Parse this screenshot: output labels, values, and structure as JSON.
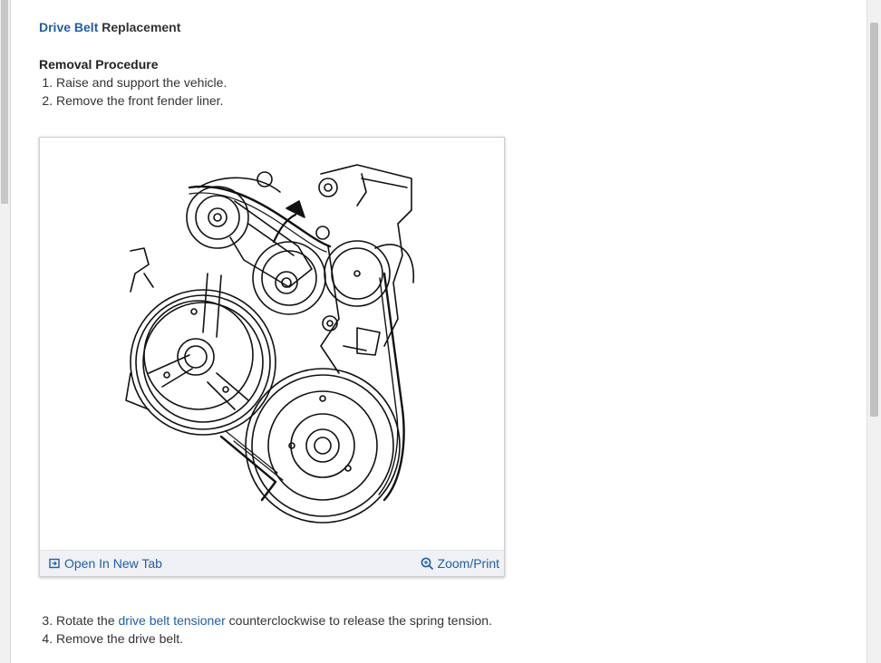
{
  "document": {
    "title_accent": "Drive Belt",
    "title_rest": " Replacement",
    "section_heading": "Removal Procedure",
    "steps_before": [
      "Raise and support the vehicle.",
      "Remove the front fender liner."
    ],
    "figure": {
      "open_new_tab_label": "Open In New Tab",
      "zoom_print_label": "Zoom/Print"
    },
    "step3": {
      "prefix": "Rotate the ",
      "link": "drive belt tensioner",
      "suffix": " counterclockwise to release the spring tension."
    },
    "step4": "Remove the drive belt."
  },
  "colors": {
    "link": "#1f5ea8",
    "toolbar_bg": "#eff1f5"
  },
  "icons": {
    "open_new_tab": "open-new-tab-icon",
    "zoom": "zoom-in-icon"
  }
}
